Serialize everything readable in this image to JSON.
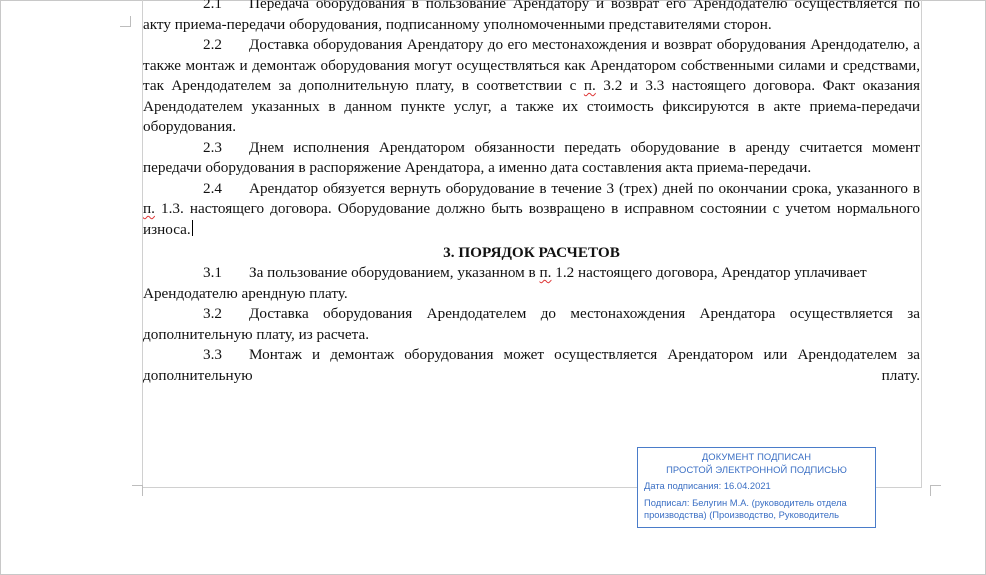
{
  "document": {
    "clause_2_1": {
      "num": "2.1",
      "text_a": "Передача оборудования в пользование Арендатору и возврат его Арендодателю осуществляется по акту приема-передачи оборудования, подписанному уполномоченными представителями сторон."
    },
    "clause_2_2": {
      "num": "2.2",
      "text_a": "Доставка оборудования Арендатору до его местонахождения и возврат оборудования Арендодателю, а также монтаж и демонтаж оборудования могут осуществляться как Арендатором собственными силами и средствами, так Арендодателем за дополнительную плату, в соответствии с",
      "ref": "п.",
      "text_b": "3.2 и 3.3 настоящего договора. Факт оказания Арендодателем указанных в данном пункте услуг, а также их стоимость фиксируются в акте приема-передачи оборудования."
    },
    "clause_2_3": {
      "num": "2.3",
      "text_a": "Днем исполнения Арендатором обязанности передать оборудование в аренду считается момент передачи оборудования в распоряжение Арендатора, а именно дата составления акта приема-передачи."
    },
    "clause_2_4": {
      "num": "2.4",
      "text_a": "Арендатор обязуется вернуть оборудование в течение 3 (трех) дней по окончании срока, указанного в",
      "ref": "п.",
      "text_b": "1.3. настоящего договора. Оборудование должно быть возвращено в исправном состоянии с учетом нормального износа."
    },
    "section_3_title": "3.  ПОРЯДОК РАСЧЕТОВ",
    "clause_3_1": {
      "num": "3.1",
      "text_a": "За пользование оборудованием, указанном в",
      "ref": "п.",
      "text_b": "1.2 настоящего договора, Арендатор уплачивает Арендодателю арендную плату."
    },
    "clause_3_2": {
      "num": "3.2",
      "text_a": "Доставка оборудования Арендодателем до местонахождения Арендатора осуществляется за дополнительную плату, из расчета."
    },
    "clause_3_3": {
      "num": "3.3",
      "text_a": "Монтаж и демонтаж оборудования может осуществляется Арендатором или Арендодателем за дополнительную плату."
    }
  },
  "stamp": {
    "title_1": "ДОКУМЕНТ ПОДПИСАН",
    "title_2": "ПРОСТОЙ ЭЛЕКТРОННОЙ ПОДПИСЬЮ",
    "date_line": "Дата подписания: 16.04.2021",
    "signer_line": "Подписал: Белугин М.А. (руководитель отдела производства) (Производство, Руководитель"
  },
  "colors": {
    "stamp_blue": "#3b6fc4",
    "spell_underline": "#d33"
  }
}
